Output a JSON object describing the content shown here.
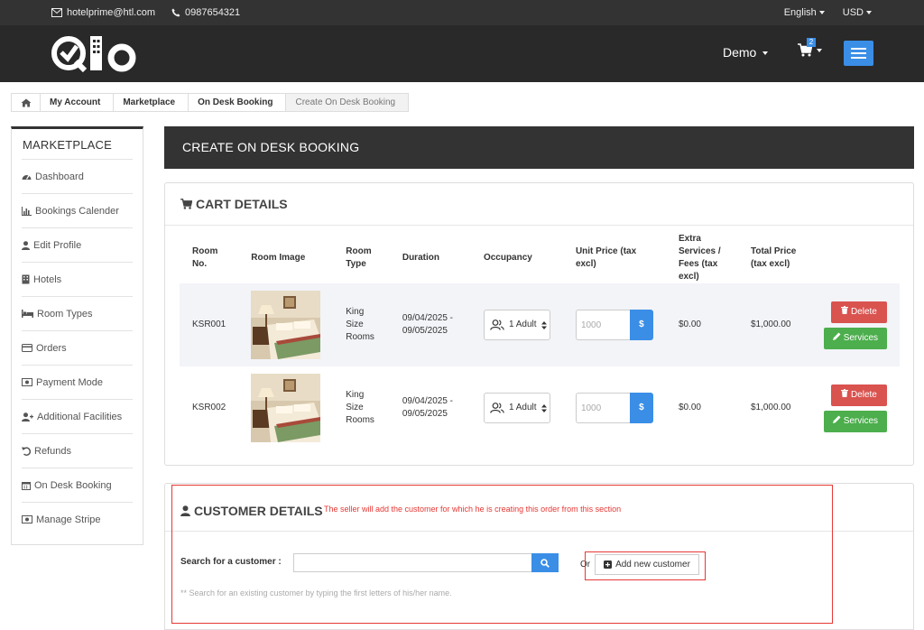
{
  "topbar": {
    "email": "hotelprime@htl.com",
    "phone": "0987654321",
    "language": "English",
    "currency": "USD"
  },
  "header": {
    "user_menu": "Demo",
    "cart_count": "2"
  },
  "breadcrumb": [
    "My Account",
    "Marketplace",
    "On Desk Booking",
    "Create On Desk Booking"
  ],
  "sidebar": {
    "title": "MARKETPLACE",
    "items": [
      {
        "label": "Dashboard",
        "icon": "dashboard-icon"
      },
      {
        "label": "Bookings Calender",
        "icon": "bar-chart-icon"
      },
      {
        "label": "Edit Profile",
        "icon": "user-icon"
      },
      {
        "label": "Hotels",
        "icon": "building-icon"
      },
      {
        "label": "Room Types",
        "icon": "bed-icon"
      },
      {
        "label": "Orders",
        "icon": "credit-card-icon"
      },
      {
        "label": "Payment Mode",
        "icon": "money-icon"
      },
      {
        "label": "Additional Facilities",
        "icon": "user-plus-icon"
      },
      {
        "label": "Refunds",
        "icon": "undo-icon"
      },
      {
        "label": "On Desk Booking",
        "icon": "calendar-icon"
      },
      {
        "label": "Manage Stripe",
        "icon": "money-icon"
      }
    ]
  },
  "main": {
    "title": "CREATE ON DESK BOOKING",
    "cart": {
      "heading": "CART DETAILS",
      "columns": {
        "room_no": "Room No.",
        "room_image": "Room Image",
        "room_type": "Room Type",
        "duration": "Duration",
        "occupancy": "Occupancy",
        "unit_price": "Unit Price (tax excl)",
        "extra": "Extra Services / Fees (tax excl)",
        "total": "Total Price (tax excl)"
      },
      "rows": [
        {
          "room_no": "KSR001",
          "room_type": "King Size Rooms",
          "duration": "09/04/2025 - 09/05/2025",
          "occupancy": "1 Adult",
          "unit_price_placeholder": "1000",
          "currency": "$",
          "extra": "$0.00",
          "total": "$1,000.00",
          "delete": "Delete",
          "services": "Services"
        },
        {
          "room_no": "KSR002",
          "room_type": "King Size Rooms",
          "duration": "09/04/2025 - 09/05/2025",
          "occupancy": "1 Adult",
          "unit_price_placeholder": "1000",
          "currency": "$",
          "extra": "$0.00",
          "total": "$1,000.00",
          "delete": "Delete",
          "services": "Services"
        }
      ]
    },
    "customer": {
      "heading": "CUSTOMER DETAILS",
      "annotation": "The seller will add the customer for which he is creating this order from this section",
      "search_label": "Search for a customer :",
      "or": "Or",
      "add_button": "Add new customer",
      "hint": "** Search for an existing customer by typing the first letters of his/her name."
    }
  },
  "colors": {
    "accent": "#3a8ee6",
    "danger": "#d9534f",
    "success": "#4cae4c",
    "annotation": "#e53935",
    "header_bg": "#292929"
  }
}
